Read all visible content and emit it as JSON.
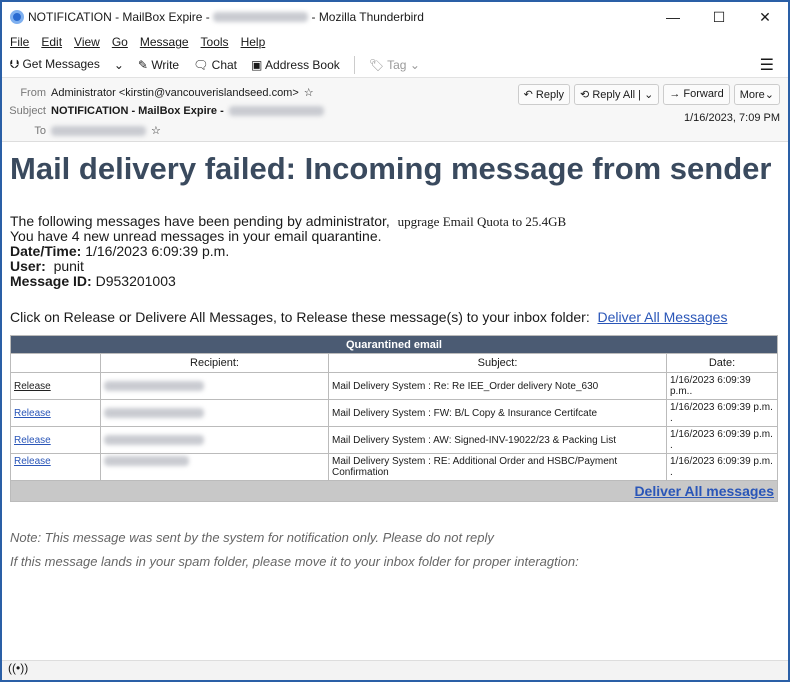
{
  "window": {
    "title_prefix": "NOTIFICATION - MailBox Expire -",
    "title_suffix": "- Mozilla Thunderbird",
    "minimize": "—",
    "maximize": "☐",
    "close": "✕"
  },
  "menu": [
    "File",
    "Edit",
    "View",
    "Go",
    "Message",
    "Tools",
    "Help"
  ],
  "toolbar": {
    "get_messages": "Get Messages",
    "write": "Write",
    "chat": "Chat",
    "address_book": "Address Book",
    "tag": "Tag",
    "menu_icon": "☰"
  },
  "header": {
    "from_label": "From",
    "from": "Administrator <kirstin@vancouverislandseed.com>",
    "subject_label": "Subject",
    "subject": "NOTIFICATION - MailBox Expire -",
    "to_label": "To",
    "date": "1/16/2023, 7:09 PM",
    "reply": "Reply",
    "reply_all": "Reply All",
    "forward": "Forward",
    "more": "More"
  },
  "message": {
    "heading": "Mail delivery failed: Incoming message from sender",
    "line1": "The following messages have been pending by administrator,",
    "line1b": "upgrage Email Quota to 25.4GB",
    "line2": "You have 4 new unread messages in your email quarantine.",
    "date_label": "Date/Time:",
    "date_value": "1/16/2023 6:09:39 p.m.",
    "user_label": "User:",
    "user_value": "punit",
    "id_label": "Message ID:",
    "id_value": "D953201003",
    "release_text": "Click on Release or Delivere All Messages, to Release these message(s) to your inbox folder:",
    "deliver_link": "Deliver All Messages",
    "table": {
      "caption": "Quarantined email",
      "headers": [
        "",
        "Recipient:",
        "Subject:",
        "Date:"
      ],
      "rows": [
        {
          "action": "Release",
          "subject": "Mail Delivery System  : Re: Re IEE_Order delivery Note_630",
          "date": "1/16/2023 6:09:39 p.m.."
        },
        {
          "action": "Release",
          "subject": "Mail Delivery System  : FW: B/L Copy &  Insurance Certifcate",
          "date": "1/16/2023 6:09:39 p.m. ."
        },
        {
          "action": "Release",
          "subject": "Mail Delivery System : AW: Signed-INV-19022/23 & Packing List",
          "date": "1/16/2023 6:09:39 p.m. ."
        },
        {
          "action": "Release",
          "subject": "Mail Delivery System :  RE: Additional Order and HSBC/Payment Confirmation",
          "date": "1/16/2023 6:09:39 p.m. ."
        }
      ],
      "footer_link": "Deliver All messages"
    },
    "note1": "Note: This message was sent by the system for notification only.  Please do not reply",
    "note2": "If this message lands in your spam folder, please move it to your inbox folder for proper interagtion:"
  },
  "status": {
    "icon": "((•))"
  }
}
